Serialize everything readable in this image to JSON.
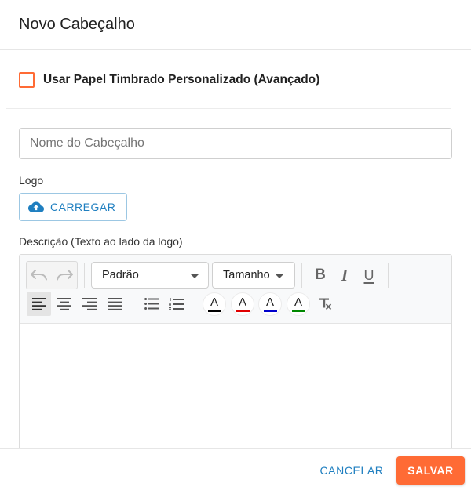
{
  "dialog": {
    "title": "Novo Cabeçalho"
  },
  "letterhead": {
    "checkbox_label": "Usar Papel Timbrado Personalizado (Avançado)",
    "checked": false
  },
  "form": {
    "name_placeholder": "Nome do Cabeçalho",
    "name_value": "",
    "logo_label": "Logo",
    "upload_label": "CARREGAR",
    "description_label": "Descrição (Texto ao lado da logo)"
  },
  "editor": {
    "font_select": "Padrão",
    "size_select": "Tamanho",
    "bold_glyph": "B",
    "italic_glyph": "I",
    "underline_glyph": "U",
    "color_letter": "A",
    "text_colors": [
      "#000000",
      "#e00000",
      "#0000cc",
      "#008800"
    ],
    "content": ""
  },
  "footer": {
    "cancel_label": "CANCELAR",
    "save_label": "SALVAR"
  },
  "colors": {
    "accent": "#ff6b35",
    "link": "#1f7fc0"
  }
}
